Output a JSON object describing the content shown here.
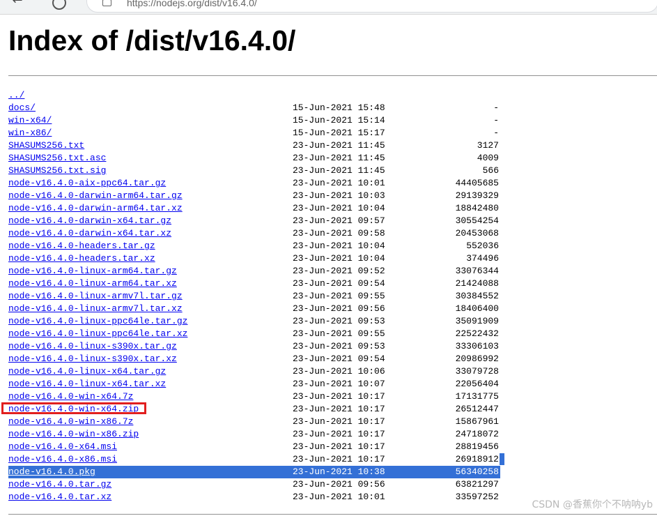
{
  "browser": {
    "url": "https://nodejs.org/dist/v16.4.0/",
    "back_icon": "arrow-left-icon",
    "reload_icon": "reload-icon",
    "lock_icon": "lock-icon"
  },
  "page": {
    "title": "Index of /dist/v16.4.0/"
  },
  "entries": [
    {
      "name": "../",
      "date": "",
      "size": ""
    },
    {
      "name": "docs/",
      "date": "15-Jun-2021 15:48",
      "size": "-"
    },
    {
      "name": "win-x64/",
      "date": "15-Jun-2021 15:14",
      "size": "-"
    },
    {
      "name": "win-x86/",
      "date": "15-Jun-2021 15:17",
      "size": "-"
    },
    {
      "name": "SHASUMS256.txt",
      "date": "23-Jun-2021 11:45",
      "size": "3127"
    },
    {
      "name": "SHASUMS256.txt.asc",
      "date": "23-Jun-2021 11:45",
      "size": "4009"
    },
    {
      "name": "SHASUMS256.txt.sig",
      "date": "23-Jun-2021 11:45",
      "size": "566"
    },
    {
      "name": "node-v16.4.0-aix-ppc64.tar.gz",
      "date": "23-Jun-2021 10:01",
      "size": "44405685"
    },
    {
      "name": "node-v16.4.0-darwin-arm64.tar.gz",
      "date": "23-Jun-2021 10:03",
      "size": "29139329"
    },
    {
      "name": "node-v16.4.0-darwin-arm64.tar.xz",
      "date": "23-Jun-2021 10:04",
      "size": "18842480"
    },
    {
      "name": "node-v16.4.0-darwin-x64.tar.gz",
      "date": "23-Jun-2021 09:57",
      "size": "30554254"
    },
    {
      "name": "node-v16.4.0-darwin-x64.tar.xz",
      "date": "23-Jun-2021 09:58",
      "size": "20453068"
    },
    {
      "name": "node-v16.4.0-headers.tar.gz",
      "date": "23-Jun-2021 10:04",
      "size": "552036"
    },
    {
      "name": "node-v16.4.0-headers.tar.xz",
      "date": "23-Jun-2021 10:04",
      "size": "374496"
    },
    {
      "name": "node-v16.4.0-linux-arm64.tar.gz",
      "date": "23-Jun-2021 09:52",
      "size": "33076344"
    },
    {
      "name": "node-v16.4.0-linux-arm64.tar.xz",
      "date": "23-Jun-2021 09:54",
      "size": "21424088"
    },
    {
      "name": "node-v16.4.0-linux-armv7l.tar.gz",
      "date": "23-Jun-2021 09:55",
      "size": "30384552"
    },
    {
      "name": "node-v16.4.0-linux-armv7l.tar.xz",
      "date": "23-Jun-2021 09:56",
      "size": "18406400"
    },
    {
      "name": "node-v16.4.0-linux-ppc64le.tar.gz",
      "date": "23-Jun-2021 09:53",
      "size": "35091909"
    },
    {
      "name": "node-v16.4.0-linux-ppc64le.tar.xz",
      "date": "23-Jun-2021 09:55",
      "size": "22522432"
    },
    {
      "name": "node-v16.4.0-linux-s390x.tar.gz",
      "date": "23-Jun-2021 09:53",
      "size": "33306103"
    },
    {
      "name": "node-v16.4.0-linux-s390x.tar.xz",
      "date": "23-Jun-2021 09:54",
      "size": "20986992"
    },
    {
      "name": "node-v16.4.0-linux-x64.tar.gz",
      "date": "23-Jun-2021 10:06",
      "size": "33079728"
    },
    {
      "name": "node-v16.4.0-linux-x64.tar.xz",
      "date": "23-Jun-2021 10:07",
      "size": "22056404"
    },
    {
      "name": "node-v16.4.0-win-x64.7z",
      "date": "23-Jun-2021 10:17",
      "size": "17131775"
    },
    {
      "name": "node-v16.4.0-win-x64.zip",
      "date": "23-Jun-2021 10:17",
      "size": "26512447"
    },
    {
      "name": "node-v16.4.0-win-x86.7z",
      "date": "23-Jun-2021 10:17",
      "size": "15867961"
    },
    {
      "name": "node-v16.4.0-win-x86.zip",
      "date": "23-Jun-2021 10:17",
      "size": "24718072"
    },
    {
      "name": "node-v16.4.0-x64.msi",
      "date": "23-Jun-2021 10:17",
      "size": "28819456"
    },
    {
      "name": "node-v16.4.0-x86.msi",
      "date": "23-Jun-2021 10:17",
      "size": "26918912"
    },
    {
      "name": "node-v16.4.0.pkg",
      "date": "23-Jun-2021 10:38",
      "size": "56340258"
    },
    {
      "name": "node-v16.4.0.tar.gz",
      "date": "23-Jun-2021 09:56",
      "size": "63821297"
    },
    {
      "name": "node-v16.4.0.tar.xz",
      "date": "23-Jun-2021 10:01",
      "size": "33597252"
    }
  ],
  "selected_entry_index": 30,
  "highlighted_entry_index": 25,
  "colors": {
    "link": "#0000ee",
    "selection": "#3470d6",
    "highlight_box": "#e11f1f"
  },
  "watermark": "CSDN @香蕉你个不呐呐yb"
}
